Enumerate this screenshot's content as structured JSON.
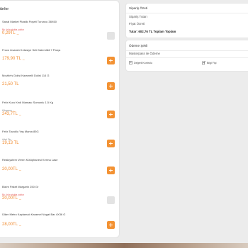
{
  "products_panel": {
    "heading": "ünler",
    "items": [
      {
        "name": "Sanal Market Plastik Poşeti Turuncu 38X60",
        "note": "Bu ürün stokta yoktur",
        "note_type": "stock",
        "price": "0,29TL",
        "price_suffix": "_",
        "available": false
      },
      {
        "name": "Frocs Lisanslı Kırtasiye Seti Kalemlikli 7 Parça",
        "note": "",
        "note_type": "",
        "price": "179,90 TL",
        "price_suffix": "_",
        "available": true
      },
      {
        "name": "Mcvitie's Dolisi Karamelli Dolisi 114 G",
        "note": "",
        "note_type": "",
        "price": "21,50 TL",
        "price_suffix": "",
        "available": true
      },
      {
        "name": "Felix Kuru Kedi Maması Somonlu 1.5 Kg",
        "note": "Kilogramı :",
        "note_type": "unit",
        "price": "243,7TL",
        "price_suffix": "_",
        "available": true
      },
      {
        "name": "Felix Tavuklu Yaş Mama 85G",
        "note": "Adet Fiy...",
        "note_type": "unit",
        "price": "19,13 TL",
        "price_suffix": "",
        "available": true
      },
      {
        "name": "Realsystem Veren Kütüphanesi Kerma Lase",
        "note": "",
        "note_type": "",
        "price": "20,00TL",
        "price_suffix": "_",
        "available": true
      },
      {
        "name": "Bizim Paket Margarin 250 Gr",
        "note": "Bu ürün stokta yoktur",
        "note_type": "stock",
        "price": "20,00TL",
        "price_suffix": "_",
        "available": false
      },
      {
        "name": "Ülker Metro Kaplamalı Karamel Nugat Bar 4X36 G",
        "note": "",
        "note_type": "",
        "price": "28,00TL",
        "price_suffix": "_",
        "available": true
      }
    ],
    "add_label": "+"
  },
  "summary": {
    "title": "Sipariş Özeti",
    "row1": "Sipariş Tutarı",
    "row2": "Fiyat Ücreti",
    "total_label": "Tutar:",
    "total_value": "602,76 TL Toplam Toplam"
  },
  "payment": {
    "title": "Ödeme Şekli",
    "method": "Masterpass ile Ödeme",
    "left_link": "Değerli Kontrolu",
    "right_link": "Bilgi Fişi",
    "left_icon": "document-icon",
    "right_icon": "edit-icon"
  },
  "colors": {
    "accent": "#f39233",
    "price": "#f08a2e",
    "stock_warning": "#e45c5c",
    "disabled": "#e3e3e3"
  }
}
